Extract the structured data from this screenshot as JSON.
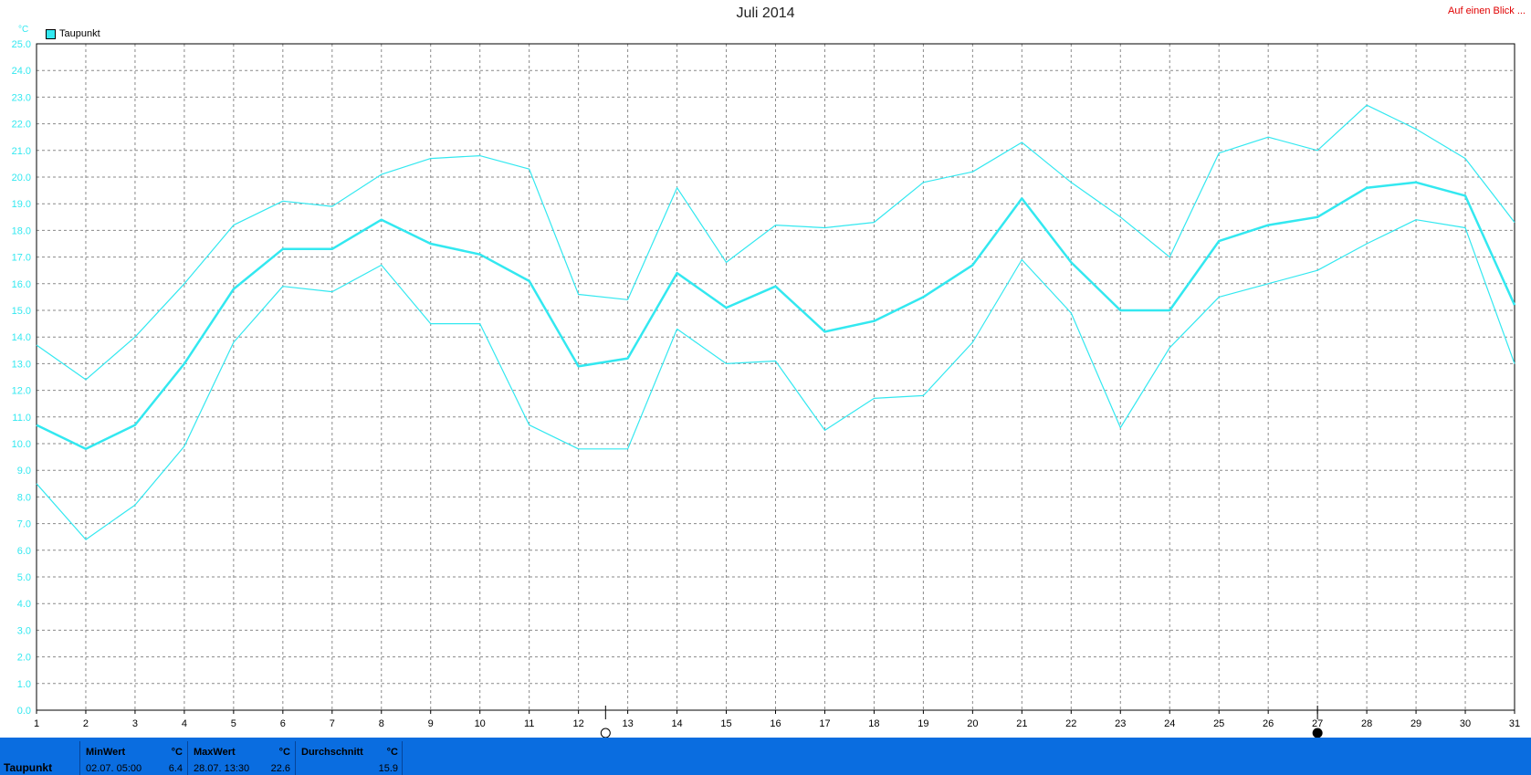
{
  "title": "Juli 2014",
  "link_label": "Auf einen Blick ...",
  "legend": {
    "label": "Taupunkt",
    "color": "#33e8f0"
  },
  "unit": "°C",
  "chart_data": {
    "type": "line",
    "title": "Juli 2014",
    "ylabel": "°C",
    "ylim": [
      0,
      25
    ],
    "xlim": [
      1,
      31
    ],
    "x": [
      1,
      2,
      3,
      4,
      5,
      6,
      7,
      8,
      9,
      10,
      11,
      12,
      13,
      14,
      15,
      16,
      17,
      18,
      19,
      20,
      21,
      22,
      23,
      24,
      25,
      26,
      27,
      28,
      29,
      30,
      31
    ],
    "xticks": [
      "1",
      "2",
      "3",
      "4",
      "5",
      "6",
      "7",
      "8",
      "9",
      "10",
      "11",
      "12",
      "13",
      "14",
      "15",
      "16",
      "17",
      "18",
      "19",
      "20",
      "21",
      "22",
      "23",
      "24",
      "25",
      "26",
      "27",
      "28",
      "29",
      "30",
      "31"
    ],
    "yticks": [
      "0.0",
      "1.0",
      "2.0",
      "3.0",
      "4.0",
      "5.0",
      "6.0",
      "7.0",
      "8.0",
      "9.0",
      "10.0",
      "11.0",
      "12.0",
      "13.0",
      "14.0",
      "15.0",
      "16.0",
      "17.0",
      "18.0",
      "19.0",
      "20.0",
      "21.0",
      "22.0",
      "23.0",
      "24.0",
      "25.0"
    ],
    "grid": true,
    "legend_position": "top-left",
    "series": [
      {
        "name": "Taupunkt",
        "color": "#33e8f0",
        "width": 2.5,
        "values": [
          10.7,
          9.8,
          10.7,
          13.0,
          15.8,
          17.3,
          17.3,
          18.4,
          17.5,
          17.1,
          16.1,
          12.9,
          13.2,
          16.4,
          15.1,
          15.9,
          14.2,
          14.6,
          15.5,
          16.7,
          19.2,
          16.8,
          15.0,
          15.0,
          17.6,
          18.2,
          18.5,
          19.6,
          19.8,
          19.3,
          15.2
        ]
      },
      {
        "color": "#33e8f0",
        "width": 1.2,
        "values": [
          13.7,
          12.4,
          14.0,
          16.0,
          18.2,
          19.1,
          18.9,
          20.1,
          20.7,
          20.8,
          20.3,
          15.6,
          15.4,
          19.6,
          16.8,
          18.2,
          18.1,
          18.3,
          19.8,
          20.2,
          21.3,
          19.8,
          18.5,
          17.0,
          20.9,
          21.5,
          21.0,
          22.7,
          21.8,
          20.7,
          18.3
        ]
      },
      {
        "color": "#33e8f0",
        "width": 1.2,
        "values": [
          8.5,
          6.4,
          7.7,
          9.9,
          13.8,
          15.9,
          15.7,
          16.7,
          14.5,
          14.5,
          10.7,
          9.8,
          9.8,
          14.3,
          13.0,
          13.1,
          10.5,
          11.7,
          11.8,
          13.8,
          16.9,
          14.9,
          10.6,
          13.6,
          15.5,
          16.0,
          16.5,
          17.5,
          18.4,
          18.1,
          13.0
        ]
      }
    ],
    "markers": [
      {
        "x": 12.55,
        "icon": "new-moon-icon",
        "fill": "#ffffff"
      },
      {
        "x": 27.0,
        "icon": "full-moon-icon",
        "fill": "#000000"
      }
    ]
  },
  "footer": {
    "row_label": "Taupunkt",
    "min": {
      "header": "MinWert",
      "unit": "°C",
      "time": "02.07.  05:00",
      "value": "6.4"
    },
    "max": {
      "header": "MaxWert",
      "unit": "°C",
      "time": "28.07.  13:30",
      "value": "22.6"
    },
    "avg": {
      "header": "Durchschnitt",
      "unit": "°C",
      "value": "15.9"
    }
  }
}
